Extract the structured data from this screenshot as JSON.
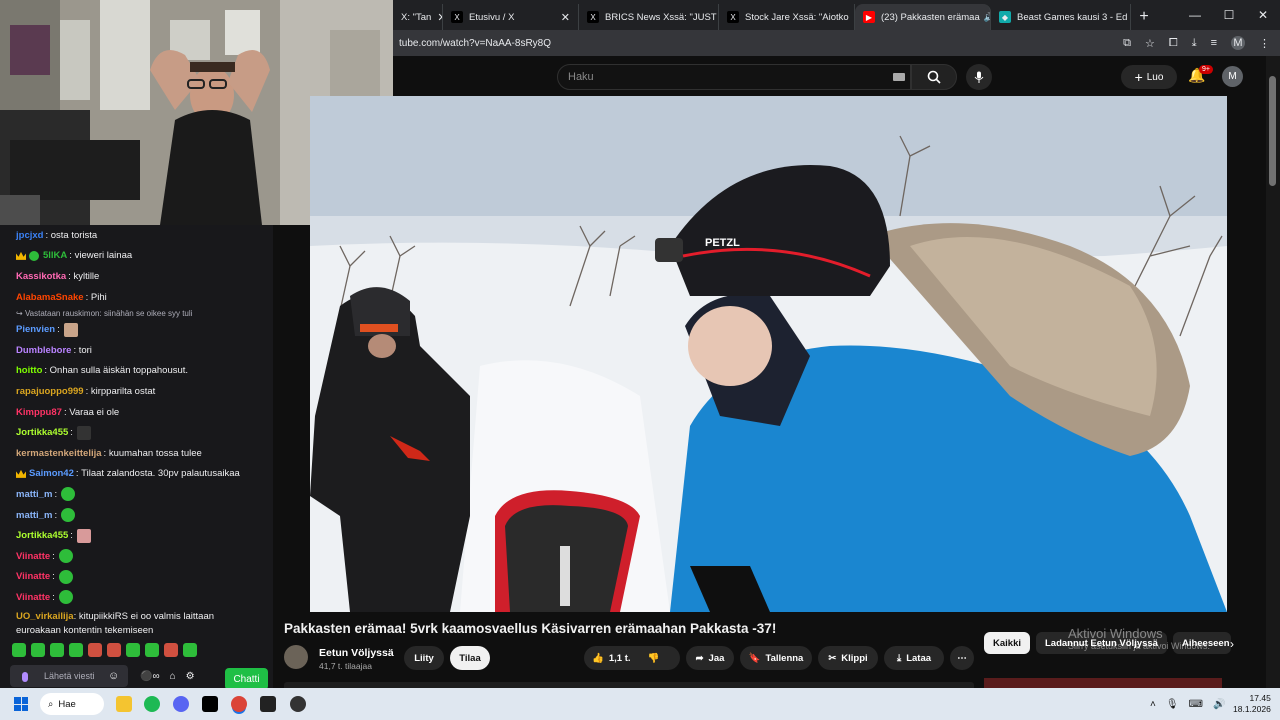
{
  "browser": {
    "tabs": [
      {
        "label": "X: \"Tan",
        "fav_color": "#555",
        "fav_glyph": ""
      },
      {
        "label": "Etusivu / X",
        "fav_color": "#000",
        "fav_glyph": "X"
      },
      {
        "label": "BRICS News Xssä: \"JUST",
        "fav_color": "#000",
        "fav_glyph": "X"
      },
      {
        "label": "Stock Jare Xssä: \"Aiotko",
        "fav_color": "#000",
        "fav_glyph": "X"
      },
      {
        "label": "(23) Pakkasten erämaa",
        "fav_color": "#ff0000",
        "fav_glyph": "▶"
      },
      {
        "label": "Beast Games kausi 3 - Ed",
        "fav_color": "#1aa",
        "fav_glyph": "◆"
      }
    ],
    "close_glyph": "✕",
    "new_tab_glyph": "+",
    "url": "tube.com/watch?v=NaAA-8sRy8Q",
    "profile_letter": "M"
  },
  "youtube": {
    "search_placeholder": "Haku",
    "create_label": "Luo",
    "notification_count": "9+",
    "avatar_letter": "M"
  },
  "chat": {
    "messages": [
      {
        "user": "jpcjxd",
        "color": "#3b82f6",
        "text": "osta torista",
        "badges": []
      },
      {
        "user": "5llKA",
        "color": "#2ebd3a",
        "text": "vieweri lainaa",
        "badges": [
          "crown",
          "clover"
        ]
      },
      {
        "user": "Kassikotka",
        "color": "#ff69b4",
        "text": "kyltille",
        "badges": []
      },
      {
        "user": "AlabamaSnake",
        "color": "#ff4500",
        "text": "Pihi",
        "badges": []
      },
      {
        "reply": "Vastataan rauskimon: siinähän se oikee syy tuli"
      },
      {
        "user": "Pienvien",
        "color": "#5b9bff",
        "text": "",
        "badges": [],
        "emote": "face"
      },
      {
        "user": "Dumblebore",
        "color": "#b983ff",
        "text": "tori",
        "badges": []
      },
      {
        "user": "hoitto",
        "color": "#7fff00",
        "text": "Onhan sulla äiskän toppahousut.",
        "badges": []
      },
      {
        "user": "rapajuoppo999",
        "color": "#daa520",
        "text": "kirpparilta ostat",
        "badges": []
      },
      {
        "user": "Kimppu87",
        "color": "#ff3366",
        "text": "Varaa ei ole",
        "badges": []
      },
      {
        "user": "Jortikka455",
        "color": "#adff2f",
        "text": "",
        "badges": [],
        "emote": "dark"
      },
      {
        "user": "kermastenkeittelija",
        "color": "#d2a679",
        "text": "kuumahan tossa tulee",
        "badges": []
      },
      {
        "user": "Saimon42",
        "color": "#5b9bff",
        "text": "Tilaat zalandosta. 30pv palautusaikaa",
        "badges": [
          "crown"
        ]
      },
      {
        "user": "matti_m",
        "color": "#8ab4f8",
        "text": "",
        "badges": [],
        "emote": "green"
      },
      {
        "user": "matti_m",
        "color": "#8ab4f8",
        "text": "",
        "badges": [],
        "emote": "green"
      },
      {
        "user": "Jortikka455",
        "color": "#adff2f",
        "text": "",
        "badges": [],
        "emote": "face"
      },
      {
        "user": "Viinatte",
        "color": "#ff3366",
        "text": "",
        "badges": [],
        "emote": "green"
      },
      {
        "user": "Viinatte",
        "color": "#ff3366",
        "text": "",
        "badges": [],
        "emote": "green"
      },
      {
        "user": "Viinatte",
        "color": "#ff3366",
        "text": "",
        "badges": [],
        "emote": "green"
      }
    ],
    "last_message": {
      "user": "UO_virkailija",
      "color": "#daa520",
      "text": "kitupiikkiRS ei oo valmis laittaan euroakaan kontentin tekemiseen"
    },
    "input_placeholder": "Lähetä viesti",
    "send_label": "Chatti"
  },
  "video": {
    "title": "Pakkasten erämaa! 5vrk kaamosvaellus Käsivarren erämaahan Pakkasta -37!",
    "channel": "Eetun Völjyssä",
    "subscribers": "41,7 t. tilaajaa",
    "join_label": "Liity",
    "subscribe_label": "Tilaa",
    "like_count": "1,1 t.",
    "share_label": "Jaa",
    "save_label": "Tallenna",
    "clip_label": "Klippi",
    "download_label": "Lataa",
    "more_glyph": "⋯"
  },
  "related_chips": [
    "Kaikki",
    "Ladannut Eetun Völjyssä",
    "Aiheeseen li"
  ],
  "activation": {
    "line1": "Aktivoi Windows",
    "line2": "Siirry asetuksiin ja aktivoi Windows."
  },
  "taskbar": {
    "search_label": "Hae",
    "time": "17.45",
    "date": "18.1.2026"
  }
}
